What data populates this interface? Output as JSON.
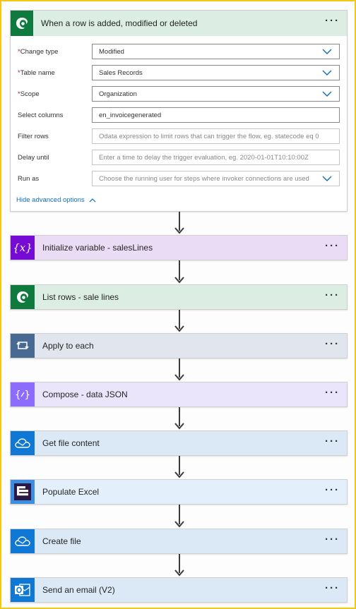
{
  "trigger": {
    "title": "When a row is added, modified or deleted",
    "icon": "dataverse-icon",
    "params": [
      {
        "label": "Change type",
        "required": true,
        "value": "Modified",
        "dropdown": true,
        "placeholder": false
      },
      {
        "label": "Table name",
        "required": true,
        "value": "Sales Records",
        "dropdown": true,
        "placeholder": false
      },
      {
        "label": "Scope",
        "required": true,
        "value": "Organization",
        "dropdown": true,
        "placeholder": false
      },
      {
        "label": "Select columns",
        "required": false,
        "value": "en_invoicegenerated",
        "dropdown": false,
        "placeholder": false
      },
      {
        "label": "Filter rows",
        "required": false,
        "value": "Odata expression to limit rows that can trigger the flow, eg. statecode eq 0",
        "dropdown": false,
        "placeholder": true
      },
      {
        "label": "Delay until",
        "required": false,
        "value": "Enter a time to delay the trigger evaluation, eg. 2020-01-01T10:10:00Z",
        "dropdown": false,
        "placeholder": true
      },
      {
        "label": "Run as",
        "required": false,
        "value": "Choose the running user for steps where invoker connections are used",
        "dropdown": true,
        "placeholder": true
      }
    ],
    "advanced_label": "Hide advanced options"
  },
  "steps": [
    {
      "title": "Initialize variable - salesLines",
      "icon": "variable-icon",
      "bg": "#ebdcf5",
      "icon_bg": "#770bd6"
    },
    {
      "title": "List rows - sale lines",
      "icon": "dataverse-icon",
      "bg": "#dceee4",
      "icon_bg": "#0e7a3d"
    },
    {
      "title": "Apply to each",
      "icon": "loop-icon",
      "bg": "#e1e6ee",
      "icon_bg": "#486991"
    },
    {
      "title": "Compose - data JSON",
      "icon": "compose-icon",
      "bg": "#ebe5fb",
      "icon_bg": "#8c6cff"
    },
    {
      "title": "Get file content",
      "icon": "onedrive-icon",
      "bg": "#dbe9f6",
      "icon_bg": "#0f78d4"
    },
    {
      "title": "Populate Excel",
      "icon": "encodian-icon",
      "bg": "#e3effb",
      "icon_bg": "#3b8ee0"
    },
    {
      "title": "Create file",
      "icon": "onedrive-icon",
      "bg": "#dbe9f6",
      "icon_bg": "#0f78d4"
    },
    {
      "title": "Send an email (V2)",
      "icon": "outlook-icon",
      "bg": "#dbe9f6",
      "icon_bg": "#0f78d4"
    }
  ],
  "more_label": "···"
}
